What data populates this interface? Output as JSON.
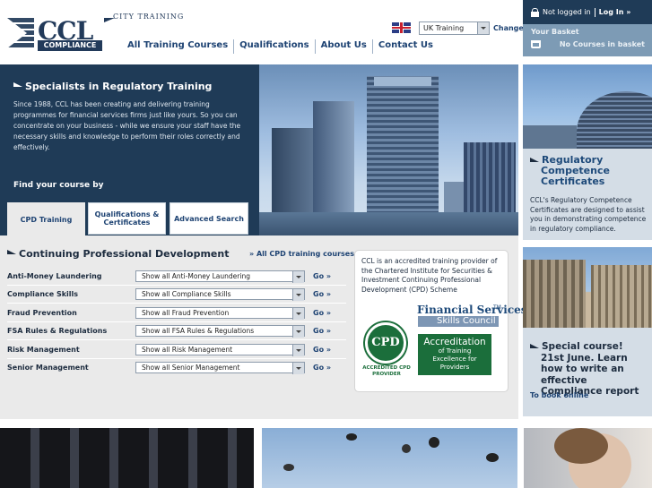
{
  "header": {
    "logo": {
      "brand": "CCL",
      "sub": "COMPLIANCE",
      "tagline": "CITY TRAINING"
    },
    "nav": [
      "All Training Courses",
      "Qualifications",
      "About Us",
      "Contact Us"
    ],
    "region": {
      "selected": "UK Training",
      "change_label": "Change"
    }
  },
  "account": {
    "status": "Not logged in",
    "login_label": "Log In »",
    "basket_title": "Your Basket",
    "basket_status": "No Courses in basket"
  },
  "hero": {
    "title": "Specialists in Regulatory Training",
    "text": "Since 1988, CCL has been creating and delivering training programmes for financial services firms just like yours. So you can concentrate on your business - while we ensure your staff have the necessary skills and knowledge to perform their roles correctly and effectively.",
    "find_label": "Find your course by",
    "tabs": [
      "CPD Training",
      "Qualifications & Certificates",
      "Advanced Search"
    ]
  },
  "cpd": {
    "heading": "Continuing Professional Development",
    "all_link": "» All CPD training courses",
    "go_label": "Go »",
    "rows": [
      {
        "label": "Anti-Money Laundering",
        "select": "Show all Anti-Money Laundering"
      },
      {
        "label": "Compliance Skills",
        "select": "Show all Compliance Skills"
      },
      {
        "label": "Fraud Prevention",
        "select": "Show all Fraud Prevention"
      },
      {
        "label": "FSA Rules & Regulations",
        "select": "Show all FSA Rules & Regulations"
      },
      {
        "label": "Risk Management",
        "select": "Show all Risk Management"
      },
      {
        "label": "Senior Management",
        "select": "Show all Senior Management"
      }
    ]
  },
  "accreditation": {
    "text": "CCL is an accredited training provider of the Chartered Institute for Securities & Investment Continuing Professional Development (CPD) Scheme",
    "cpd_badge": "CPD",
    "cpd_caption": "ACCREDITED CPD PROVIDER",
    "fs_title": "Financial Services",
    "fs_tm": "TM",
    "fs_sub": "Skills Council",
    "accr_heading": "Accreditation",
    "accr_sub": "of Training Excellence for Providers"
  },
  "sidebar": {
    "promo1_title": "Regulatory Competence Certificates",
    "promo1_text": "CCL's Regulatory Competence Certificates are designed to assist you in demonstrating competence in regulatory compliance.",
    "promo2_title": "Special course! 21st June. Learn how to write an effective Compliance report",
    "promo2_link": "To book online"
  }
}
